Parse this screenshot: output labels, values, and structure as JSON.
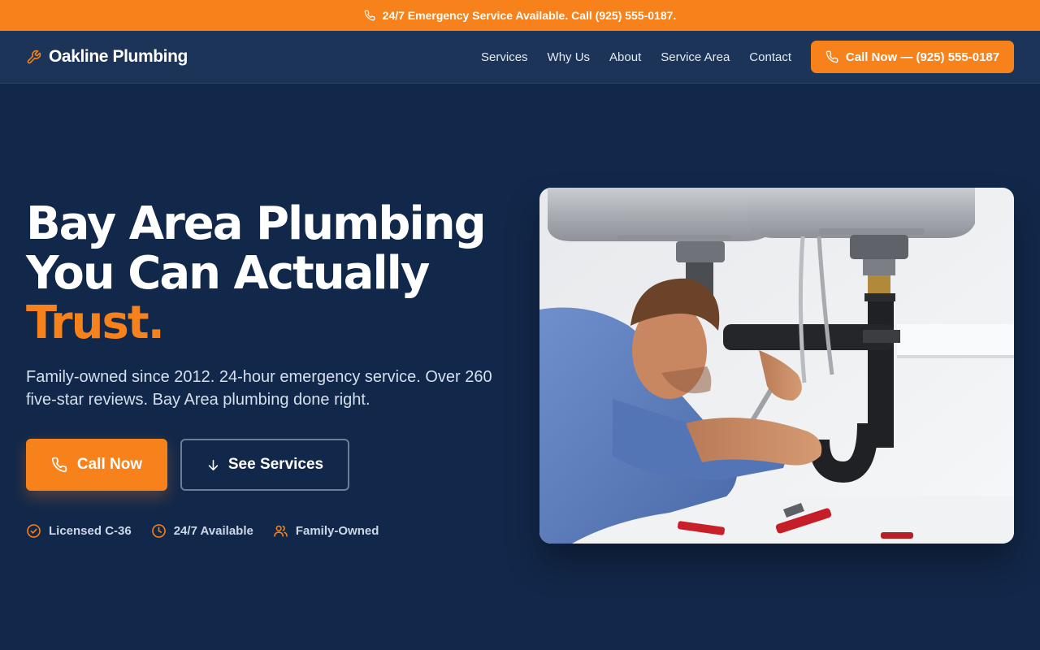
{
  "topbar": {
    "icon": "phone-icon",
    "text": "24/7 Emergency Service Available. Call (925) 555-0187."
  },
  "nav": {
    "brand": {
      "icon": "wrench-icon",
      "name": "Oakline Plumbing"
    },
    "links": [
      "Services",
      "Why Us",
      "About",
      "Service Area",
      "Contact"
    ],
    "cta": {
      "icon": "phone-icon",
      "label": "Call Now — (925) 555-0187"
    }
  },
  "hero": {
    "headline_line1": "Bay Area Plumbing",
    "headline_line2": "You Can Actually",
    "headline_accent": "Trust.",
    "subtext": "Family-owned since 2012. 24-hour emergency service. Over 260 five-star reviews. Bay Area plumbing done right.",
    "primary_cta": {
      "icon": "phone-icon",
      "label": "Call Now"
    },
    "secondary_cta": {
      "icon": "arrow-down-icon",
      "label": "See Services"
    },
    "badges": [
      {
        "icon": "check-circle-icon",
        "label": "Licensed C-36"
      },
      {
        "icon": "clock-icon",
        "label": "24/7 Available"
      },
      {
        "icon": "users-icon",
        "label": "Family-Owned"
      }
    ],
    "image": {
      "subject": "plumber-repairing-sink-pipes"
    }
  },
  "colors": {
    "accent": "#f7811a",
    "page_bg": "#12284a",
    "nav_bg": "#1c3457",
    "text": "#ffffff",
    "muted_text": "#d6dfec"
  }
}
